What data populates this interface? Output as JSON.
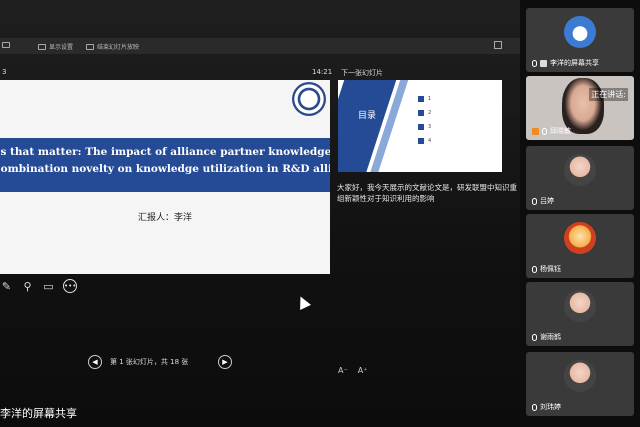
{
  "toolbar": {
    "item1_label": "显示设置",
    "item2_label": "结束幻灯片放映"
  },
  "presenter": {
    "slide_number": "3",
    "timer": "14:21",
    "current_slide": {
      "title_line1": "Ties that matter: The impact of alliance partner knowledge",
      "title_line2": "recombination novelty on knowledge utilization in R&D alliances",
      "presenter_line": "汇报人：李洋"
    },
    "next_label": "下一张幻灯片",
    "next_slide": {
      "heading": "目录",
      "items": [
        "1",
        "2",
        "3",
        "4"
      ]
    },
    "notes": "大家好，我今天展示的文献论文是，研发联盟中知识重组新颖性对于知识利用的影响",
    "tools": [
      "pen-icon",
      "search-icon",
      "screen-icon",
      "more-icon"
    ],
    "nav": {
      "prev": "◀",
      "next": "▶",
      "counter": "第 1 张幻灯片，共 18 张"
    },
    "mini_tools": [
      "A⁻",
      "A⁺"
    ]
  },
  "share_label": "李洋的屏幕共享",
  "participants": [
    {
      "name": "李洋的屏幕共享",
      "type": "logo"
    },
    {
      "name": "邱晓敏",
      "type": "video",
      "status": "正在讲话:"
    },
    {
      "name": "吕婷",
      "type": "photo"
    },
    {
      "name": "杨佩钰",
      "type": "cartoon"
    },
    {
      "name": "谢雨鹤",
      "type": "photo"
    },
    {
      "name": "刘玮婷",
      "type": "photo"
    }
  ]
}
